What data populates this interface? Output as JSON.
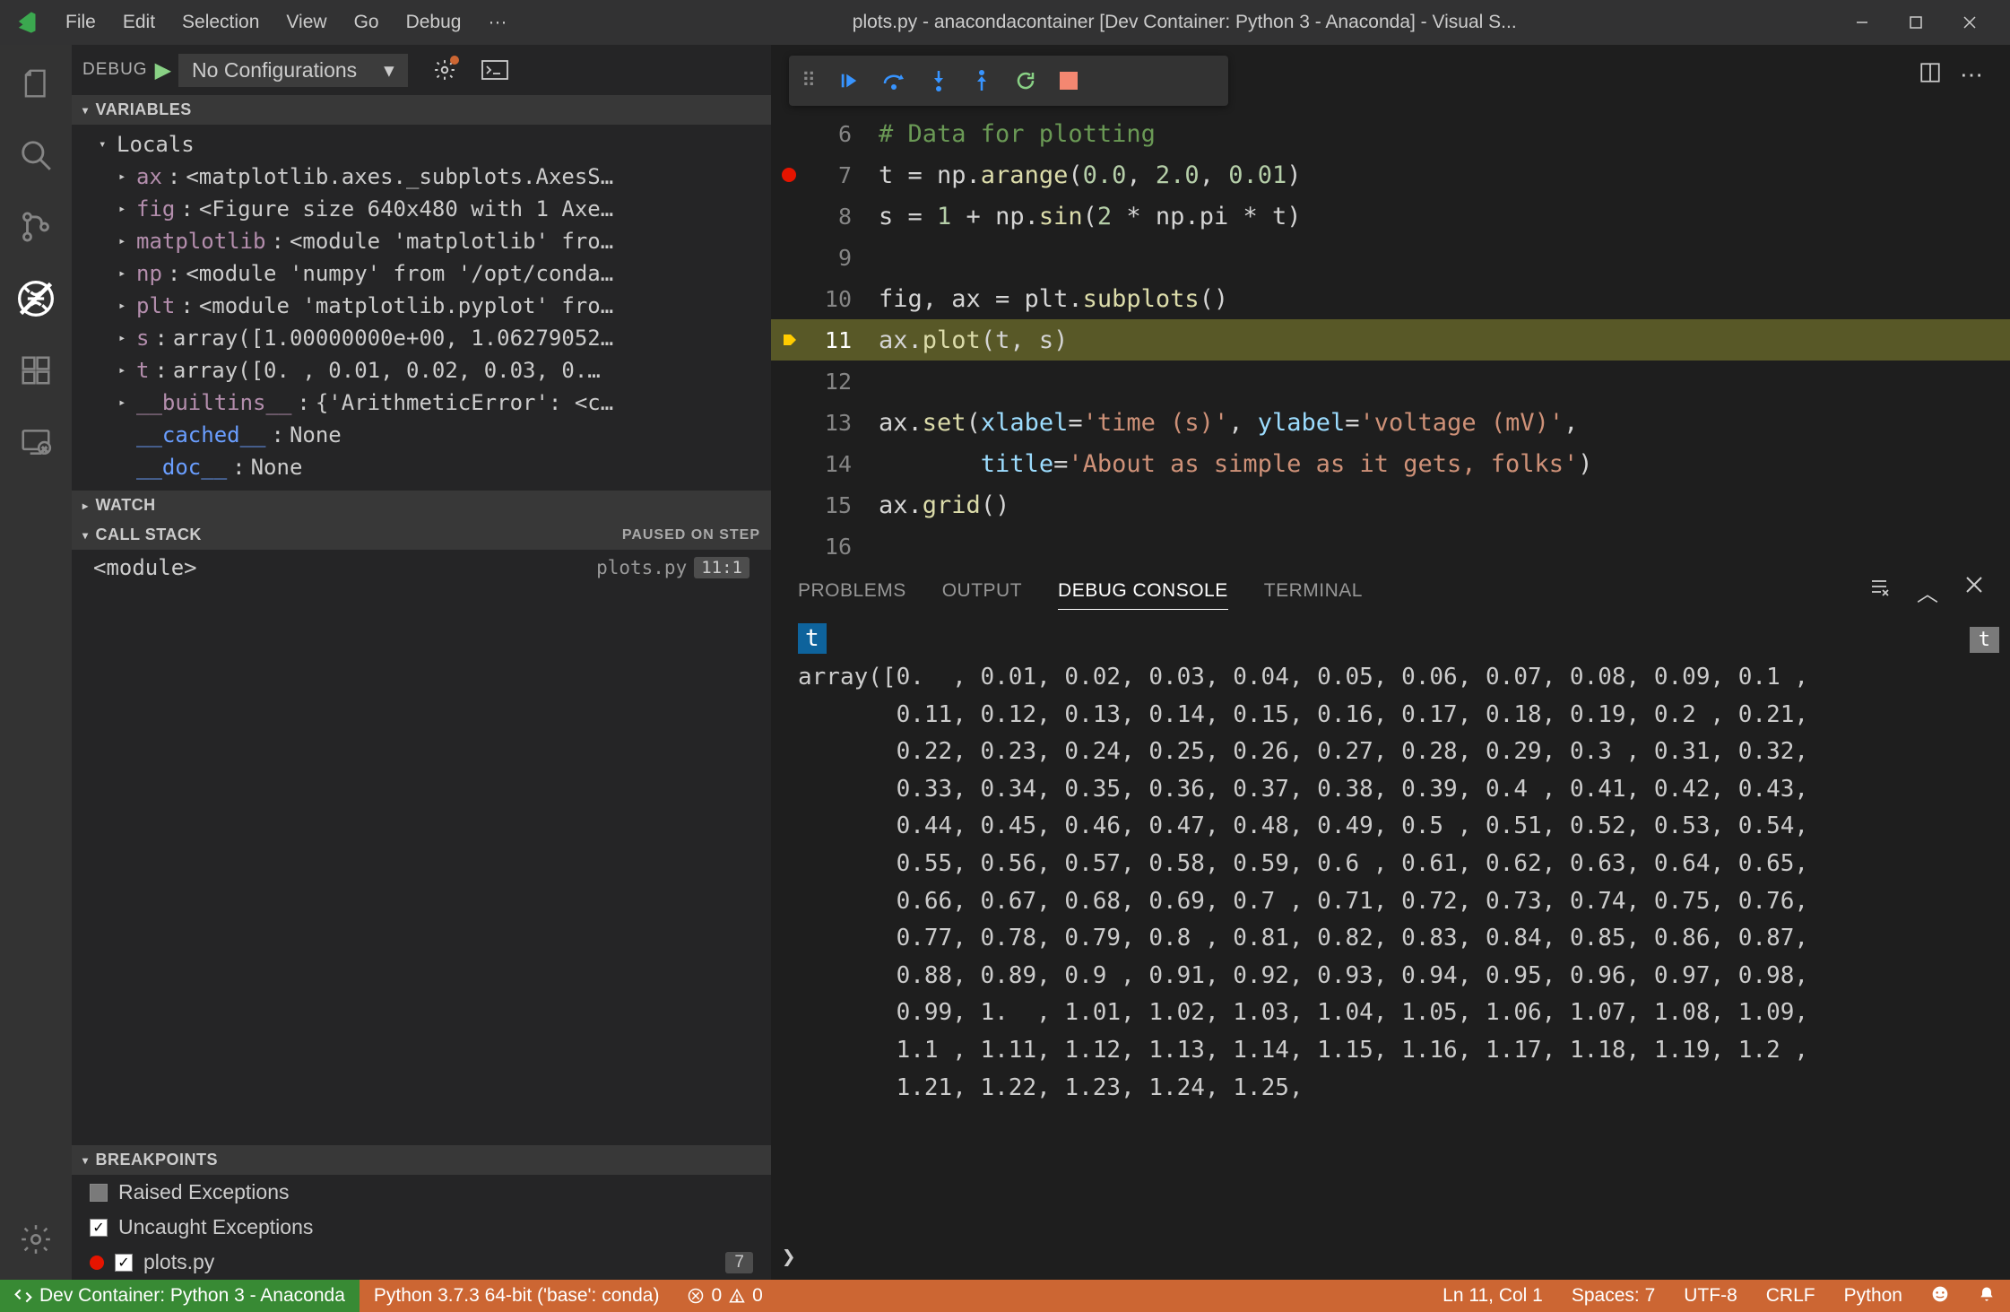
{
  "title": "plots.py - anacondacontainer [Dev Container: Python 3 - Anaconda] - Visual S...",
  "menu": [
    "File",
    "Edit",
    "Selection",
    "View",
    "Go",
    "Debug",
    "···"
  ],
  "debug": {
    "label": "DEBUG",
    "config": "No Configurations"
  },
  "sections": {
    "variables": "VARIABLES",
    "locals": "Locals",
    "watch": "WATCH",
    "callstack": "CALL STACK",
    "callstack_status": "PAUSED ON STEP",
    "breakpoints": "BREAKPOINTS"
  },
  "variables": [
    {
      "name": "ax",
      "value": "<matplotlib.axes._subplots.AxesS…"
    },
    {
      "name": "fig",
      "value": "<Figure size 640x480 with 1 Axe…"
    },
    {
      "name": "matplotlib",
      "value": "<module 'matplotlib' fro…"
    },
    {
      "name": "np",
      "value": "<module 'numpy' from '/opt/conda…"
    },
    {
      "name": "plt",
      "value": "<module 'matplotlib.pyplot' fro…"
    },
    {
      "name": "s",
      "value": "array([1.00000000e+00, 1.06279052…"
    },
    {
      "name": "t",
      "value": "array([0.  , 0.01, 0.02, 0.03, 0.…"
    },
    {
      "name": "__builtins__",
      "value": "{'ArithmeticError': <c…"
    }
  ],
  "specials": [
    {
      "name": "__cached__",
      "value": "None"
    },
    {
      "name": "__doc__",
      "value": "None"
    }
  ],
  "callstack": {
    "frame": "<module>",
    "file": "plots.py",
    "loc": "11:1"
  },
  "breakpoints": {
    "raised": "Raised Exceptions",
    "uncaught": "Uncaught Exceptions",
    "file": "plots.py",
    "count": "7"
  },
  "code": {
    "lines": [
      {
        "n": 6
      },
      {
        "n": 7,
        "bp": true
      },
      {
        "n": 8
      },
      {
        "n": 9
      },
      {
        "n": 10
      },
      {
        "n": 11,
        "cur": true
      },
      {
        "n": 12
      },
      {
        "n": 13
      },
      {
        "n": 14
      },
      {
        "n": 15
      },
      {
        "n": 16
      }
    ],
    "l6": "# Data for plotting",
    "l7_a": "t = np.",
    "l7_b": "arange",
    "l7_c": "(",
    "l7_d": "0.0",
    "l7_e": ", ",
    "l7_f": "2.0",
    "l7_g": ", ",
    "l7_h": "0.01",
    "l7_i": ")",
    "l8_a": "s = ",
    "l8_b": "1",
    "l8_c": " + np.",
    "l8_d": "sin",
    "l8_e": "(",
    "l8_f": "2",
    "l8_g": " * np.pi * t)",
    "l10_a": "fig, ax = plt.",
    "l10_b": "subplots",
    "l10_c": "()",
    "l11_a": "ax.",
    "l11_b": "plot",
    "l11_c": "(t, s)",
    "l13_a": "ax.",
    "l13_b": "set",
    "l13_c": "(",
    "l13_d": "xlabel",
    "l13_e": "=",
    "l13_f": "'time (s)'",
    "l13_g": ", ",
    "l13_h": "ylabel",
    "l13_i": "=",
    "l13_j": "'voltage (mV)'",
    "l13_k": ",",
    "l14_a": "       ",
    "l14_b": "title",
    "l14_c": "=",
    "l14_d": "'About as simple as it gets, folks'",
    "l14_e": ")",
    "l15_a": "ax.",
    "l15_b": "grid",
    "l15_c": "()"
  },
  "panel": {
    "tabs": [
      "PROBLEMS",
      "OUTPUT",
      "DEBUG CONSOLE",
      "TERMINAL"
    ],
    "active": 2,
    "prompt_echo": "t",
    "badge": "t",
    "output": "array([0.  , 0.01, 0.02, 0.03, 0.04, 0.05, 0.06, 0.07, 0.08, 0.09, 0.1 ,\\n       0.11, 0.12, 0.13, 0.14, 0.15, 0.16, 0.17, 0.18, 0.19, 0.2 , 0.21,\\n       0.22, 0.23, 0.24, 0.25, 0.26, 0.27, 0.28, 0.29, 0.3 , 0.31, 0.32,\\n       0.33, 0.34, 0.35, 0.36, 0.37, 0.38, 0.39, 0.4 , 0.41, 0.42, 0.43,\\n       0.44, 0.45, 0.46, 0.47, 0.48, 0.49, 0.5 , 0.51, 0.52, 0.53, 0.54,\\n       0.55, 0.56, 0.57, 0.58, 0.59, 0.6 , 0.61, 0.62, 0.63, 0.64, 0.65,\\n       0.66, 0.67, 0.68, 0.69, 0.7 , 0.71, 0.72, 0.73, 0.74, 0.75, 0.76,\\n       0.77, 0.78, 0.79, 0.8 , 0.81, 0.82, 0.83, 0.84, 0.85, 0.86, 0.87,\\n       0.88, 0.89, 0.9 , 0.91, 0.92, 0.93, 0.94, 0.95, 0.96, 0.97, 0.98,\\n       0.99, 1.  , 1.01, 1.02, 1.03, 1.04, 1.05, 1.06, 1.07, 1.08, 1.09,\\n       1.1 , 1.11, 1.12, 1.13, 1.14, 1.15, 1.16, 1.17, 1.18, 1.19, 1.2 ,\\n       1.21, 1.22, 1.23, 1.24, 1.25,"
  },
  "status": {
    "remote": "Dev Container: Python 3 - Anaconda",
    "interpreter": "Python 3.7.3 64-bit ('base': conda)",
    "errors": "0",
    "warnings": "0",
    "position": "Ln 11, Col 1",
    "spaces": "Spaces: 7",
    "encoding": "UTF-8",
    "eol": "CRLF",
    "lang": "Python"
  }
}
